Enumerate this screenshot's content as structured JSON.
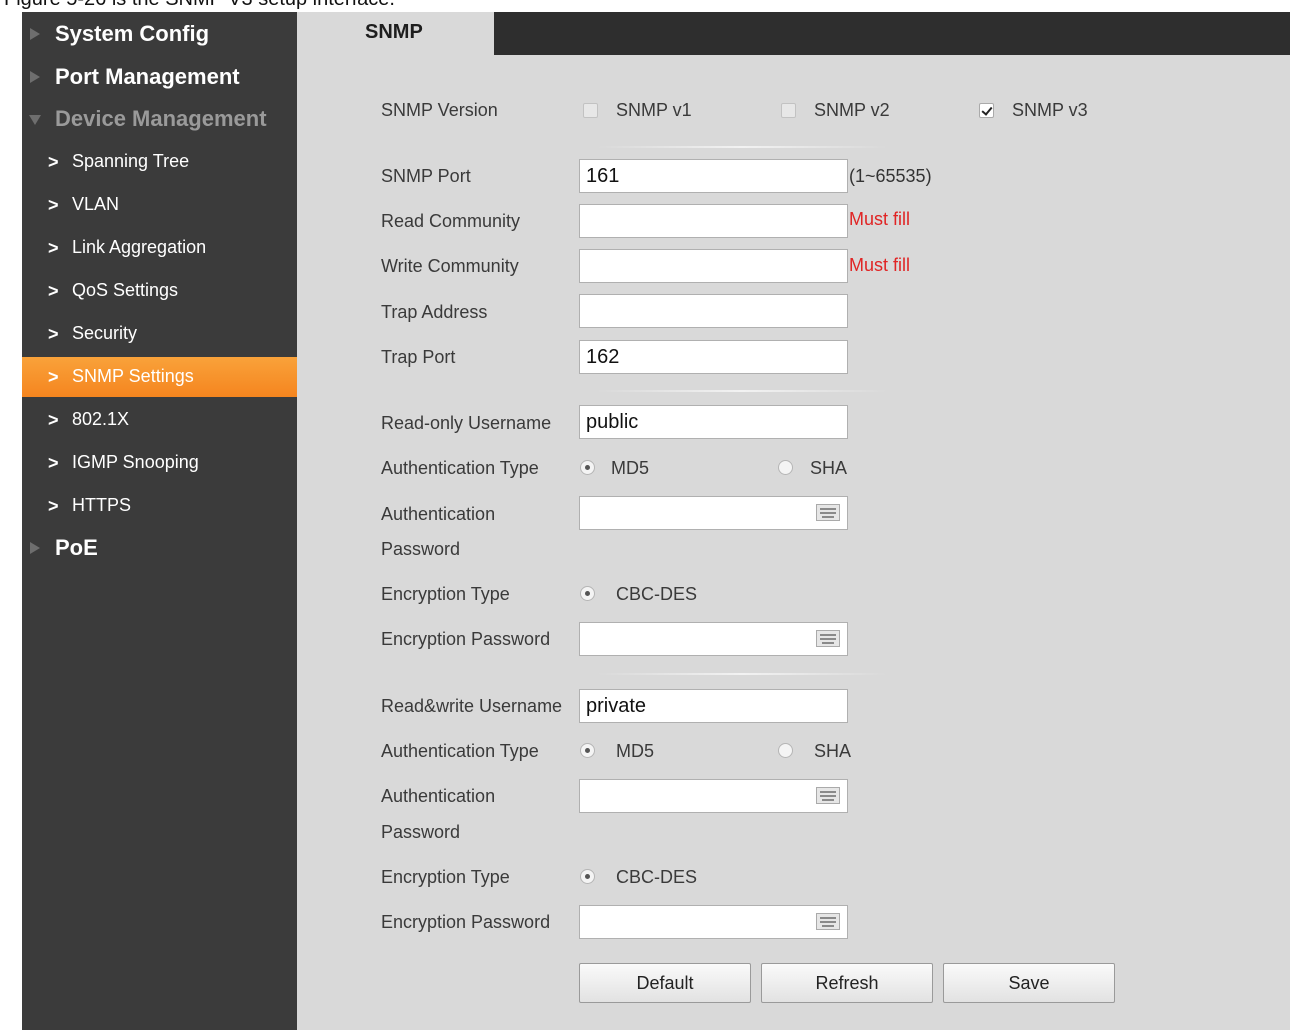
{
  "caption": "Figure 5-26 is the SNMP V3 setup interface.",
  "sidebar": {
    "categories": [
      {
        "label": "System Config"
      },
      {
        "label": "Port Management"
      },
      {
        "label": "Device Management"
      },
      {
        "label": "PoE"
      }
    ],
    "items": [
      {
        "label": "Spanning Tree"
      },
      {
        "label": "VLAN"
      },
      {
        "label": "Link Aggregation"
      },
      {
        "label": "QoS Settings"
      },
      {
        "label": "Security"
      },
      {
        "label": "SNMP Settings"
      },
      {
        "label": "802.1X"
      },
      {
        "label": "IGMP Snooping"
      },
      {
        "label": "HTTPS"
      }
    ],
    "active_item": "SNMP Settings"
  },
  "tab": {
    "label": "SNMP"
  },
  "form": {
    "version": {
      "label": "SNMP Version",
      "v1": {
        "label": "SNMP v1",
        "checked": false
      },
      "v2": {
        "label": "SNMP v2",
        "checked": false
      },
      "v3": {
        "label": "SNMP v3",
        "checked": true
      }
    },
    "snmp_port": {
      "label": "SNMP Port",
      "value": "161",
      "hint": "(1~65535)"
    },
    "read_community": {
      "label": "Read Community",
      "value": "",
      "required": "Must fill"
    },
    "write_community": {
      "label": "Write Community",
      "value": "",
      "required": "Must fill"
    },
    "trap_address": {
      "label": "Trap Address",
      "value": ""
    },
    "trap_port": {
      "label": "Trap Port",
      "value": "162"
    },
    "ro": {
      "username_label": "Read-only Username",
      "username": "public",
      "auth_type_label": "Authentication Type",
      "md5": "MD5",
      "sha": "SHA",
      "auth_type_selected": "MD5",
      "auth_password_label_1": "Authentication",
      "auth_password_label_2": "Password",
      "enc_type_label": "Encryption Type",
      "enc_type": "CBC-DES",
      "enc_password_label": "Encryption Password"
    },
    "rw": {
      "username_label": "Read&write Username",
      "username": "private",
      "auth_type_label": "Authentication Type",
      "md5": "MD5",
      "sha": "SHA",
      "auth_type_selected": "MD5",
      "auth_password_label_1": "Authentication",
      "auth_password_label_2": "Password",
      "enc_type_label": "Encryption Type",
      "enc_type": "CBC-DES",
      "enc_password_label": "Encryption Password"
    }
  },
  "buttons": {
    "default": "Default",
    "refresh": "Refresh",
    "save": "Save"
  },
  "colors": {
    "sidebar_bg": "#3b3b3b",
    "active": "#f5851f",
    "content_bg": "#d9d9d9",
    "required": "#e02424"
  }
}
